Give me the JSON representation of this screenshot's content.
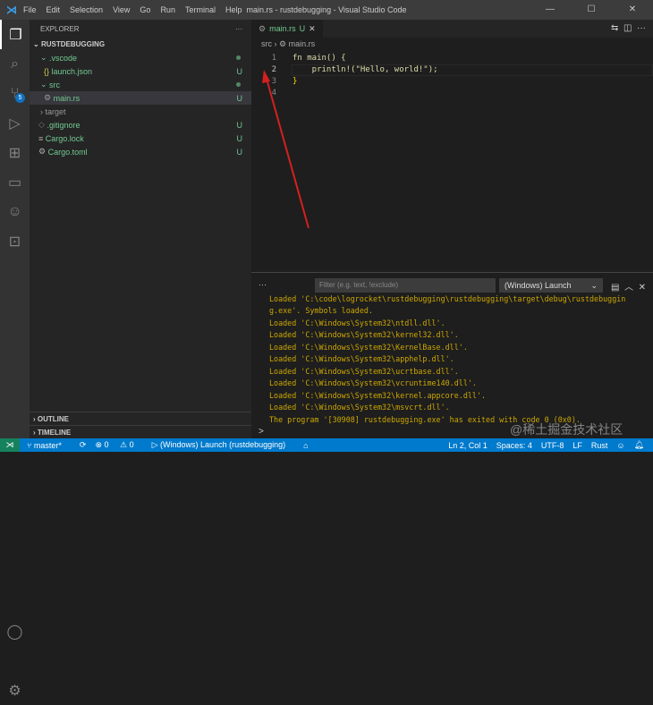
{
  "titlebar": {
    "menu": [
      "File",
      "Edit",
      "Selection",
      "View",
      "Go",
      "Run",
      "Terminal",
      "Help"
    ],
    "title": "main.rs - rustdebugging - Visual Studio Code"
  },
  "activity": {
    "scm_badge": "5"
  },
  "explorer": {
    "header": "EXPLORER",
    "project": "RUSTDEBUGGING",
    "items": [
      {
        "label": ".vscode",
        "status": "dot"
      },
      {
        "label": "launch.json",
        "status": "U"
      },
      {
        "label": "src",
        "status": "dot"
      },
      {
        "label": "main.rs",
        "status": "U"
      },
      {
        "label": "target",
        "status": ""
      },
      {
        "label": ".gitignore",
        "status": "U"
      },
      {
        "label": "Cargo.lock",
        "status": "U"
      },
      {
        "label": "Cargo.toml",
        "status": "U"
      }
    ],
    "outline": "OUTLINE",
    "timeline": "TIMELINE"
  },
  "editor": {
    "tab": "main.rs",
    "tab_status": "U",
    "breadcrumb": [
      "src",
      "main.rs"
    ],
    "lines": [
      {
        "n": "1",
        "text": "fn main() {"
      },
      {
        "n": "2",
        "text": "    println!(\"Hello, world!\");"
      },
      {
        "n": "3",
        "text": "}"
      },
      {
        "n": "4",
        "text": ""
      }
    ]
  },
  "panel": {
    "filter_placeholder": "Filter (e.g. text, !exclude)",
    "launch_config": "(Windows) Launch",
    "output": [
      "Loaded 'C:\\code\\logrocket\\rustdebugging\\rustdebugging\\target\\debug\\rustdebuggin",
      "g.exe'. Symbols loaded.",
      "Loaded 'C:\\Windows\\System32\\ntdll.dll'.",
      "Loaded 'C:\\Windows\\System32\\kernel32.dll'.",
      "Loaded 'C:\\Windows\\System32\\KernelBase.dll'.",
      "Loaded 'C:\\Windows\\System32\\apphelp.dll'.",
      "Loaded 'C:\\Windows\\System32\\ucrtbase.dll'.",
      "Loaded 'C:\\Windows\\System32\\vcruntime140.dll'.",
      "Loaded 'C:\\Windows\\System32\\kernel.appcore.dll'.",
      "Loaded 'C:\\Windows\\System32\\msvcrt.dll'.",
      "The program '[30908] rustdebugging.exe' has exited with code 0 (0x0)."
    ],
    "prompt": ">"
  },
  "statusbar": {
    "branch": "master*",
    "errors": "0",
    "warnings": "0",
    "debug": "(Windows) Launch (rustdebugging)",
    "position": "Ln 2, Col 1",
    "spaces": "Spaces: 4",
    "encoding": "UTF-8",
    "eol": "LF",
    "language": "Rust"
  },
  "watermark": "@稀土掘金技术社区"
}
